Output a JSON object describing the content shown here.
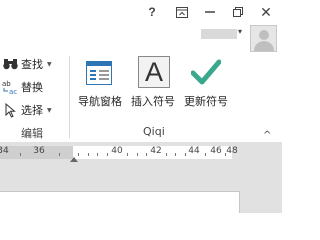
{
  "titlebar": {
    "help_label": "?",
    "options_icon": "ribbon-display-options-icon",
    "minimize_icon": "minimize-icon",
    "restore_icon": "restore-icon",
    "close_label": "✕"
  },
  "account": {
    "avatar_icon": "user-avatar-icon",
    "chevron": "▾"
  },
  "ribbon": {
    "editing_group": {
      "label": "编辑",
      "find": {
        "label": "查找",
        "icon": "binoculars-icon"
      },
      "replace": {
        "label": "替换",
        "icon": "replace-icon"
      },
      "select": {
        "label": "选择",
        "icon": "cursor-icon"
      }
    },
    "qiqi_group": {
      "label": "Qiqi",
      "navigation_pane": {
        "label": "导航窗格",
        "icon": "navigation-pane-icon"
      },
      "insert_symbol": {
        "label": "插入符号",
        "icon_glyph": "A"
      },
      "update_symbol": {
        "label": "更新符号",
        "icon": "checkmark-icon"
      }
    },
    "collapse_chevron": "^"
  },
  "ruler": {
    "labels": [
      "34",
      "36",
      "40",
      "42",
      "44",
      "46",
      "48"
    ]
  },
  "colors": {
    "accent_blue": "#2e75b6",
    "check_teal": "#3aa88c",
    "workspace_gray": "#e1e1e1"
  }
}
